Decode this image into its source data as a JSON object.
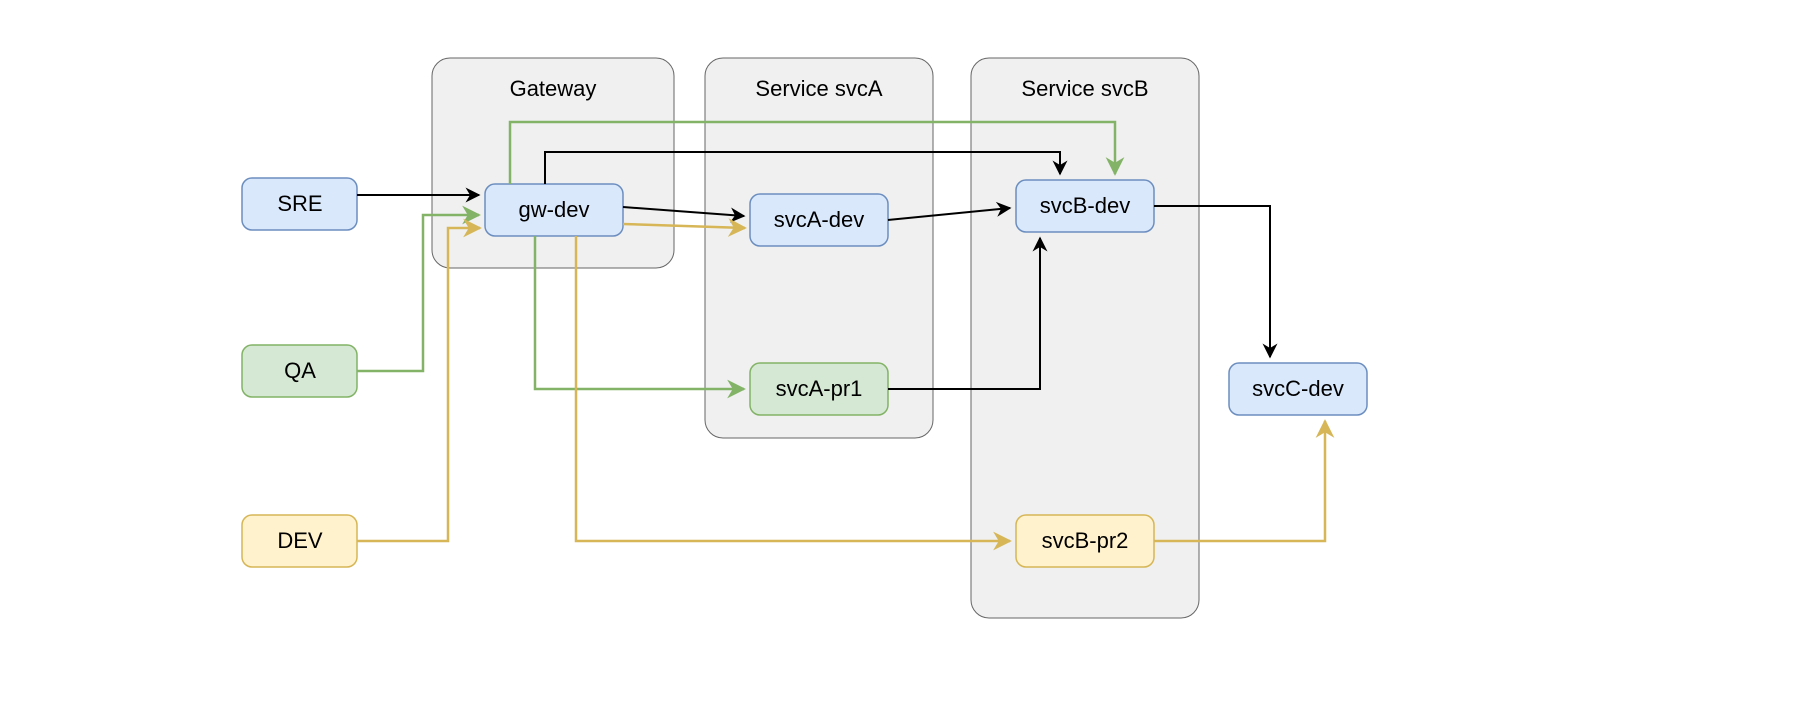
{
  "actors": {
    "sre": "SRE",
    "qa": "QA",
    "dev": "DEV"
  },
  "groups": {
    "gateway": "Gateway",
    "svcA": "Service svcA",
    "svcB": "Service svcB"
  },
  "nodes": {
    "gw_dev": "gw-dev",
    "svcA_dev": "svcA-dev",
    "svcA_pr1": "svcA-pr1",
    "svcB_dev": "svcB-dev",
    "svcB_pr2": "svcB-pr2",
    "svcC_dev": "svcC-dev"
  },
  "colors": {
    "blue_fill": "#dae8fc",
    "blue_stroke": "#6c8ebf",
    "green_fill": "#d5e8d4",
    "green_stroke": "#82b366",
    "yellow_fill": "#fff2cc",
    "yellow_stroke": "#d6b656",
    "group_fill": "#f0f0f0",
    "group_stroke": "#666666",
    "edge_black": "#000000"
  },
  "edges": [
    {
      "from": "SRE",
      "to": "gw-dev",
      "color": "black"
    },
    {
      "from": "QA",
      "to": "gw-dev",
      "color": "green"
    },
    {
      "from": "DEV",
      "to": "gw-dev",
      "color": "yellow"
    },
    {
      "from": "gw-dev",
      "to": "svcA-dev",
      "color": "black"
    },
    {
      "from": "gw-dev",
      "to": "svcB-dev",
      "color": "black"
    },
    {
      "from": "svcA-dev",
      "to": "svcB-dev",
      "color": "black"
    },
    {
      "from": "gw-dev",
      "to": "svcA-pr1",
      "color": "green"
    },
    {
      "from": "svcA-pr1",
      "to": "svcB-dev",
      "color": "black"
    },
    {
      "from": "gw-dev",
      "to": "svcB-dev",
      "color": "green"
    },
    {
      "from": "gw-dev",
      "to": "svcA-dev",
      "color": "yellow"
    },
    {
      "from": "gw-dev",
      "to": "svcB-pr2",
      "color": "yellow"
    },
    {
      "from": "svcB-dev",
      "to": "svcC-dev",
      "color": "black"
    },
    {
      "from": "svcB-pr2",
      "to": "svcC-dev",
      "color": "yellow"
    }
  ]
}
